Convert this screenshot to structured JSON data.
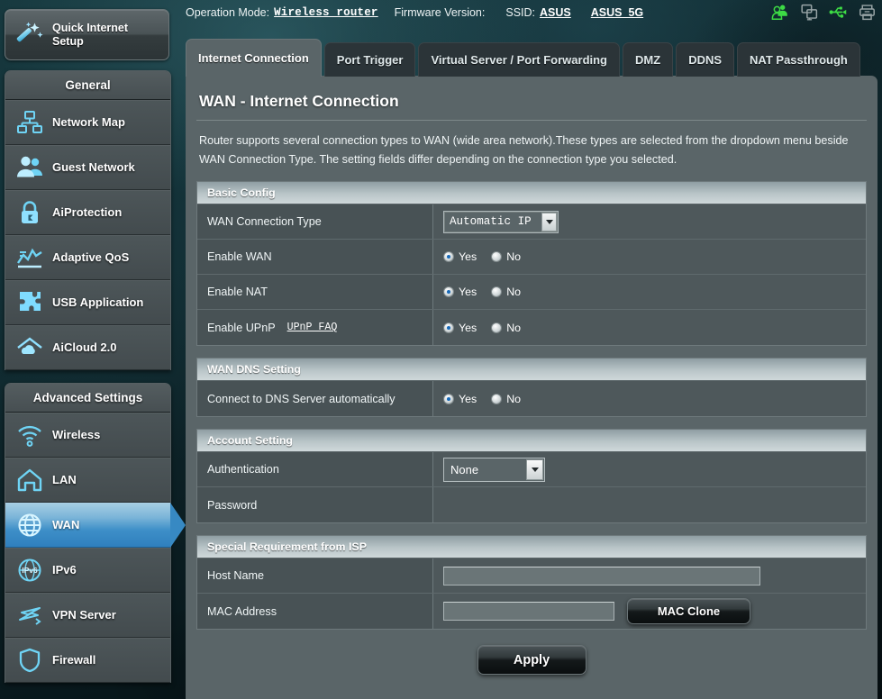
{
  "topbar": {
    "operation_mode_label": "Operation Mode:",
    "operation_mode_value": "Wireless router",
    "firmware_label": "Firmware Version:",
    "firmware_value": "",
    "ssid_label": "SSID:",
    "ssid_1": "ASUS",
    "ssid_2": "ASUS_5G",
    "icons": [
      {
        "name": "clients-icon",
        "color": "#3ddb45"
      },
      {
        "name": "screens-icon",
        "color": "#98a4a6"
      },
      {
        "name": "usb-icon",
        "color": "#3ddb45"
      },
      {
        "name": "printer-icon",
        "color": "#98a4a6"
      }
    ]
  },
  "quick_setup": {
    "line1": "Quick Internet",
    "line2": "Setup",
    "icon": "magic-wand-icon"
  },
  "sidebar": {
    "groups": [
      {
        "title": "General",
        "items": [
          {
            "label": "Network Map",
            "icon": "network-map-icon",
            "active": false
          },
          {
            "label": "Guest Network",
            "icon": "guest-network-icon",
            "active": false
          },
          {
            "label": "AiProtection",
            "icon": "lock-icon",
            "active": false
          },
          {
            "label": "Adaptive QoS",
            "icon": "chart-icon",
            "active": false
          },
          {
            "label": "USB Application",
            "icon": "puzzle-icon",
            "active": false
          },
          {
            "label": "AiCloud 2.0",
            "icon": "cloud-house-icon",
            "active": false
          }
        ]
      },
      {
        "title": "Advanced Settings",
        "items": [
          {
            "label": "Wireless",
            "icon": "wifi-icon",
            "active": false
          },
          {
            "label": "LAN",
            "icon": "house-icon",
            "active": false
          },
          {
            "label": "WAN",
            "icon": "globe-icon",
            "active": true
          },
          {
            "label": "IPv6",
            "icon": "ipv6-globe-icon",
            "active": false
          },
          {
            "label": "VPN Server",
            "icon": "vpn-arrows-icon",
            "active": false
          },
          {
            "label": "Firewall",
            "icon": "shield-icon",
            "active": false
          }
        ]
      }
    ]
  },
  "tabs": [
    {
      "label": "Internet Connection",
      "active": true
    },
    {
      "label": "Port Trigger",
      "active": false
    },
    {
      "label": "Virtual Server / Port Forwarding",
      "active": false
    },
    {
      "label": "DMZ",
      "active": false
    },
    {
      "label": "DDNS",
      "active": false
    },
    {
      "label": "NAT Passthrough",
      "active": false
    }
  ],
  "main": {
    "title": "WAN - Internet Connection",
    "description": "Router supports several connection types to WAN (wide area network).These types are selected from the dropdown menu beside WAN Connection Type. The setting fields differ depending on the connection type you selected.",
    "basic_config": {
      "heading": "Basic Config",
      "wan_connection_type_label": "WAN Connection Type",
      "wan_connection_type_value": "Automatic IP",
      "enable_wan_label": "Enable WAN",
      "enable_wan_value": "Yes",
      "enable_nat_label": "Enable NAT",
      "enable_nat_value": "Yes",
      "enable_upnp_label": "Enable UPnP",
      "enable_upnp_faq": "UPnP FAQ",
      "enable_upnp_value": "Yes",
      "yes_label": "Yes",
      "no_label": "No"
    },
    "wan_dns": {
      "heading": "WAN DNS Setting",
      "connect_dns_label": "Connect to DNS Server automatically",
      "connect_dns_value": "Yes",
      "yes_label": "Yes",
      "no_label": "No"
    },
    "account_setting": {
      "heading": "Account Setting",
      "authentication_label": "Authentication",
      "authentication_value": "None",
      "password_label": "Password",
      "password_value": ""
    },
    "special_requirement": {
      "heading": "Special Requirement from ISP",
      "host_name_label": "Host Name",
      "host_name_value": "",
      "mac_address_label": "MAC Address",
      "mac_address_value": "",
      "mac_clone_label": "MAC Clone"
    },
    "apply_label": "Apply"
  },
  "colors": {
    "panel": "#5a6568",
    "row": "#4e585b",
    "accent_blue": "#3e8fc8",
    "icon_glow": "#6fd4f5",
    "status_green": "#3ddb45"
  }
}
